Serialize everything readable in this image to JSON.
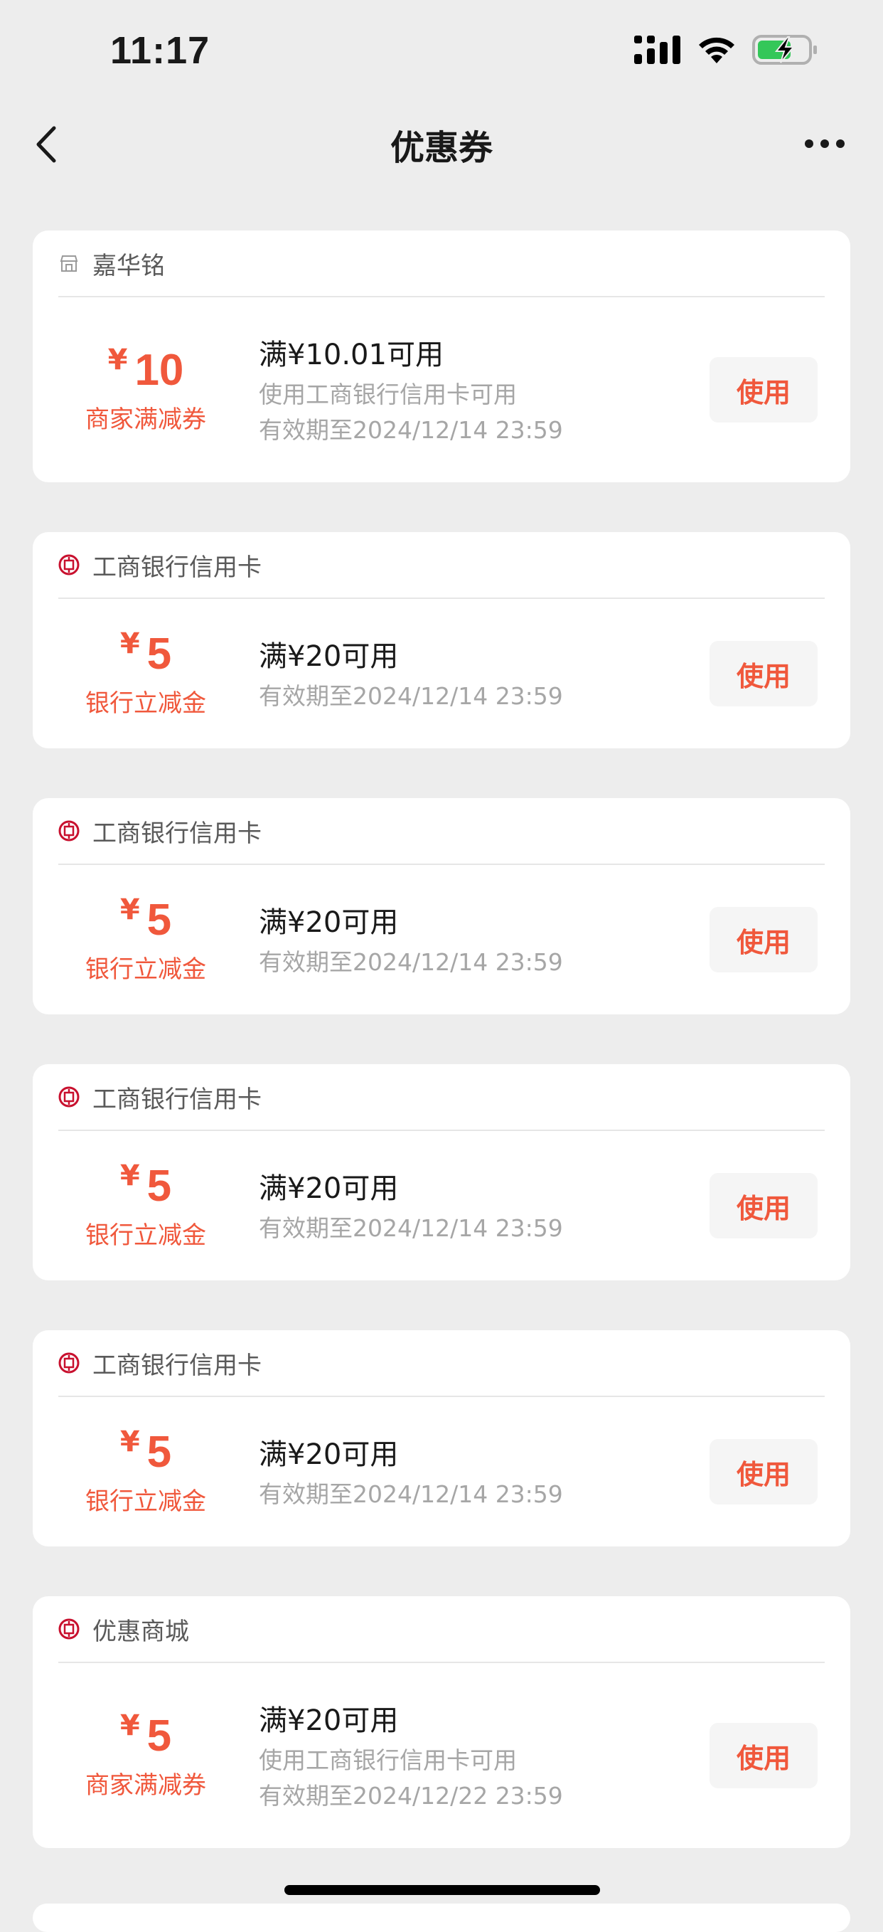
{
  "status_bar": {
    "time": "11:17"
  },
  "nav": {
    "title": "优惠券"
  },
  "coupons": [
    {
      "header": "嘉华铭",
      "header_icon": "store-icon",
      "currency": "¥",
      "amount": "10",
      "type": "商家满减券",
      "threshold": "满¥10.01可用",
      "lines": [
        "使用工商银行信用卡可用",
        "有效期至2024/12/14 23:59"
      ],
      "button": "使用"
    },
    {
      "header": "工商银行信用卡",
      "header_icon": "icbc-logo-icon",
      "currency": "¥",
      "amount": "5",
      "type": "银行立减金",
      "threshold": "满¥20可用",
      "lines": [
        "有效期至2024/12/14 23:59"
      ],
      "button": "使用"
    },
    {
      "header": "工商银行信用卡",
      "header_icon": "icbc-logo-icon",
      "currency": "¥",
      "amount": "5",
      "type": "银行立减金",
      "threshold": "满¥20可用",
      "lines": [
        "有效期至2024/12/14 23:59"
      ],
      "button": "使用"
    },
    {
      "header": "工商银行信用卡",
      "header_icon": "icbc-logo-icon",
      "currency": "¥",
      "amount": "5",
      "type": "银行立减金",
      "threshold": "满¥20可用",
      "lines": [
        "有效期至2024/12/14 23:59"
      ],
      "button": "使用"
    },
    {
      "header": "工商银行信用卡",
      "header_icon": "icbc-logo-icon",
      "currency": "¥",
      "amount": "5",
      "type": "银行立减金",
      "threshold": "满¥20可用",
      "lines": [
        "有效期至2024/12/14 23:59"
      ],
      "button": "使用"
    },
    {
      "header": "优惠商城",
      "header_icon": "icbc-logo-icon",
      "currency": "¥",
      "amount": "5",
      "type": "商家满减券",
      "threshold": "满¥20可用",
      "lines": [
        "使用工商银行信用卡可用",
        "有效期至2024/12/22 23:59"
      ],
      "button": "使用"
    }
  ],
  "colors": {
    "accent": "#f0583c",
    "background": "#ededed",
    "card": "#ffffff"
  }
}
